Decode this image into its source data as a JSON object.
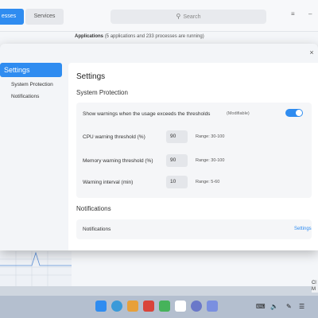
{
  "background_app": {
    "tabs": [
      {
        "label": "esses",
        "active": true
      },
      {
        "label": "Services",
        "active": false
      }
    ],
    "search_placeholder": "Search",
    "search_icon": "search-icon",
    "applications_label": "Applications",
    "applications_detail": "(5 applications and 233 processes are running)",
    "window_controls": [
      "≡",
      "–"
    ],
    "side_text": "Cl M"
  },
  "dialog": {
    "close_glyph": "×",
    "sidebar": {
      "items": [
        {
          "label": "Settings",
          "active": true
        },
        {
          "label": "System Protection",
          "active": false
        },
        {
          "label": "Notifications",
          "active": false
        }
      ]
    },
    "title": "Settings",
    "system_protection": {
      "heading": "System Protection",
      "warnings_label": "Show warnings when the usage exceeds the thresholds",
      "warnings_hint": "(Modifiable)",
      "warnings_enabled": true,
      "rows": [
        {
          "label": "CPU warning threshold (%)",
          "value": "90",
          "range": "Range: 30-100"
        },
        {
          "label": "Memory warning threshold (%)",
          "value": "90",
          "range": "Range: 30-100"
        },
        {
          "label": "Warning interval (min)",
          "value": "10",
          "range": "Range: 5-60"
        }
      ]
    },
    "notifications": {
      "heading": "Notifications",
      "row_label": "Notifications",
      "link_label": "Settings"
    }
  },
  "dock": {
    "accent": "#2f8cf0"
  }
}
